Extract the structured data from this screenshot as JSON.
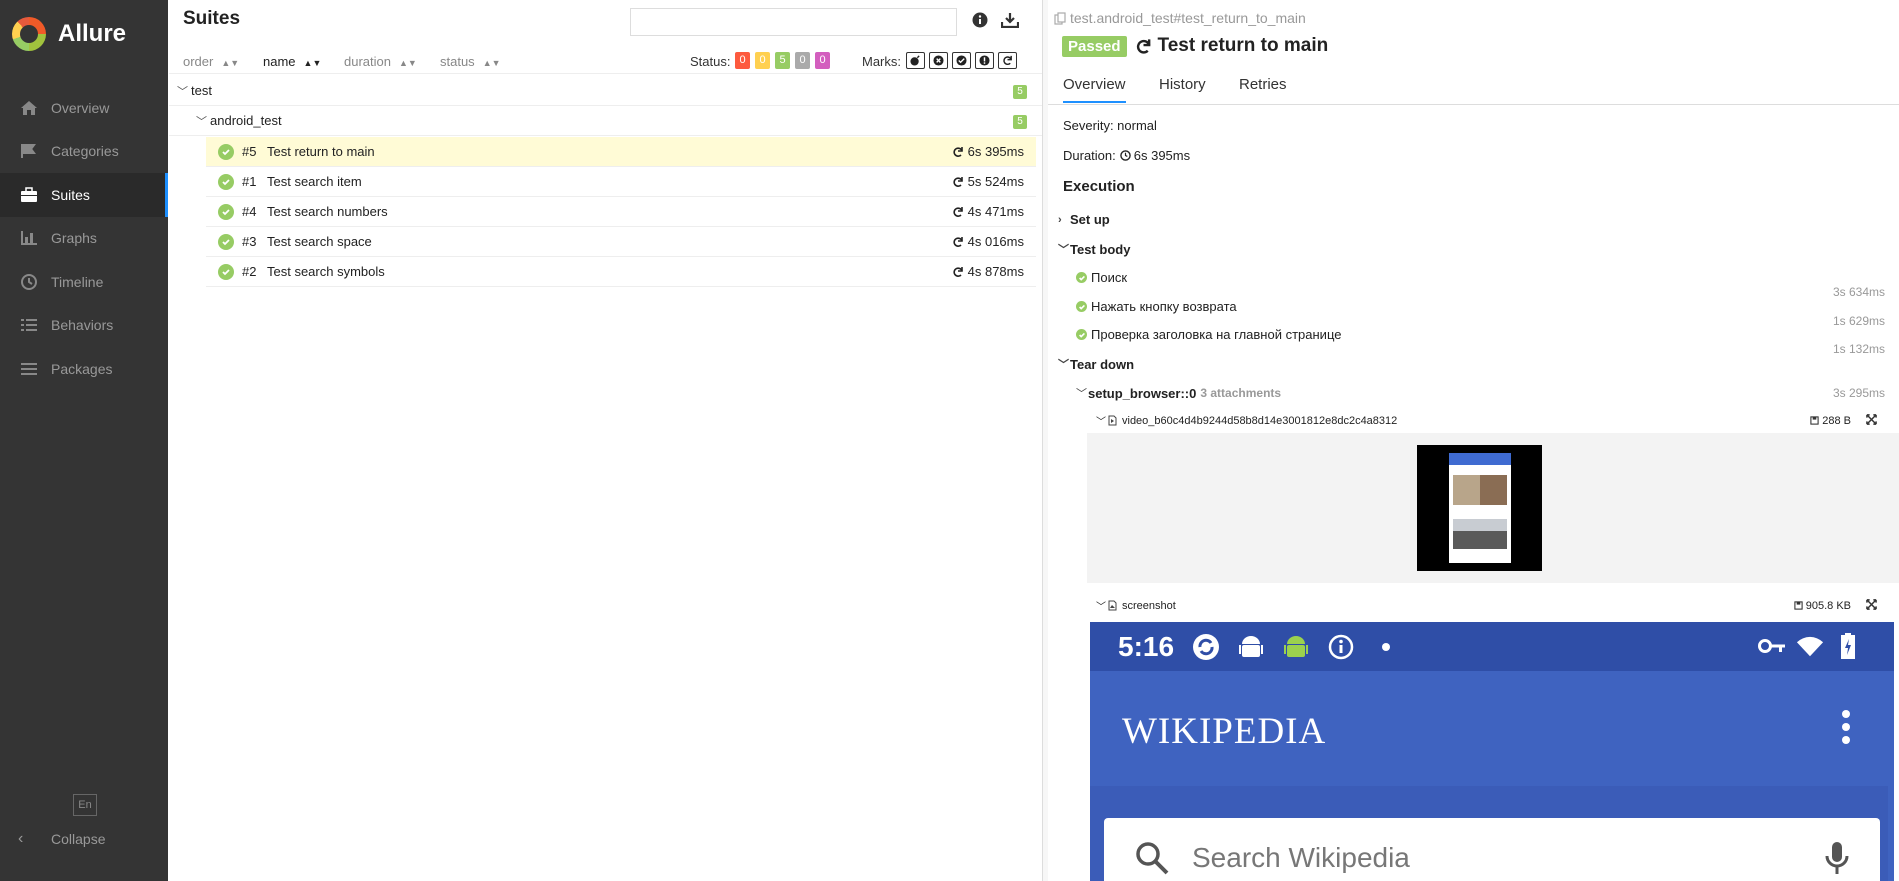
{
  "sidebar": {
    "brand": "Allure",
    "items": [
      {
        "label": "Overview",
        "icon": "home-icon"
      },
      {
        "label": "Categories",
        "icon": "flag-icon"
      },
      {
        "label": "Suites",
        "icon": "briefcase-icon",
        "active": true
      },
      {
        "label": "Graphs",
        "icon": "bar-chart-icon"
      },
      {
        "label": "Timeline",
        "icon": "clock-icon"
      },
      {
        "label": "Behaviors",
        "icon": "list-icon"
      },
      {
        "label": "Packages",
        "icon": "lines-icon"
      }
    ],
    "language": "En",
    "collapse": "Collapse"
  },
  "middle": {
    "title": "Suites",
    "sort": {
      "order": "order",
      "name": "name",
      "duration": "duration",
      "status": "status"
    },
    "status_label": "Status:",
    "status_counts": [
      {
        "value": "0",
        "color": "#fd5a3e"
      },
      {
        "value": "0",
        "color": "#ffd050"
      },
      {
        "value": "5",
        "color": "#97cc64"
      },
      {
        "value": "0",
        "color": "#aaaaaa"
      },
      {
        "value": "0",
        "color": "#d35ebe"
      }
    ],
    "marks_label": "Marks:",
    "tree": {
      "root": {
        "name": "test",
        "count": "5"
      },
      "child": {
        "name": "android_test",
        "count": "5"
      },
      "tests": [
        {
          "num": "#5",
          "name": "Test return to main",
          "duration": "6s 395ms"
        },
        {
          "num": "#1",
          "name": "Test search item",
          "duration": "5s 524ms"
        },
        {
          "num": "#4",
          "name": "Test search numbers",
          "duration": "4s 471ms"
        },
        {
          "num": "#3",
          "name": "Test search space",
          "duration": "4s 016ms"
        },
        {
          "num": "#2",
          "name": "Test search symbols",
          "duration": "4s 878ms"
        }
      ]
    }
  },
  "detail": {
    "breadcrumb": "test.android_test#test_return_to_main",
    "status": "Passed",
    "title": "Test return to main",
    "tabs": [
      "Overview",
      "History",
      "Retries"
    ],
    "severity": "Severity: normal",
    "duration_label": "Duration:",
    "duration": "6s 395ms",
    "execution": "Execution",
    "set_up": "Set up",
    "test_body": "Test body",
    "steps": [
      {
        "name": "Поиск",
        "duration": "3s 634ms"
      },
      {
        "name": "Нажать кнопку возврата",
        "duration": "1s 629ms"
      },
      {
        "name": "Проверка заголовка на главной странице",
        "duration": "1s 132ms"
      }
    ],
    "tear_down": "Tear down",
    "fixture": {
      "name": "setup_browser::0",
      "attachments": "3 attachments",
      "duration": "3s 295ms"
    },
    "attachments": [
      {
        "name": "video_b60c4d4b9244d58b8d14e3001812e8dc2c4a8312",
        "size": "288 B"
      },
      {
        "name": "screenshot",
        "size": "905.8 KB"
      }
    ],
    "screenshot": {
      "time": "5:16",
      "brand": "WIKIPEDIA",
      "search_placeholder": "Search Wikipedia"
    }
  }
}
